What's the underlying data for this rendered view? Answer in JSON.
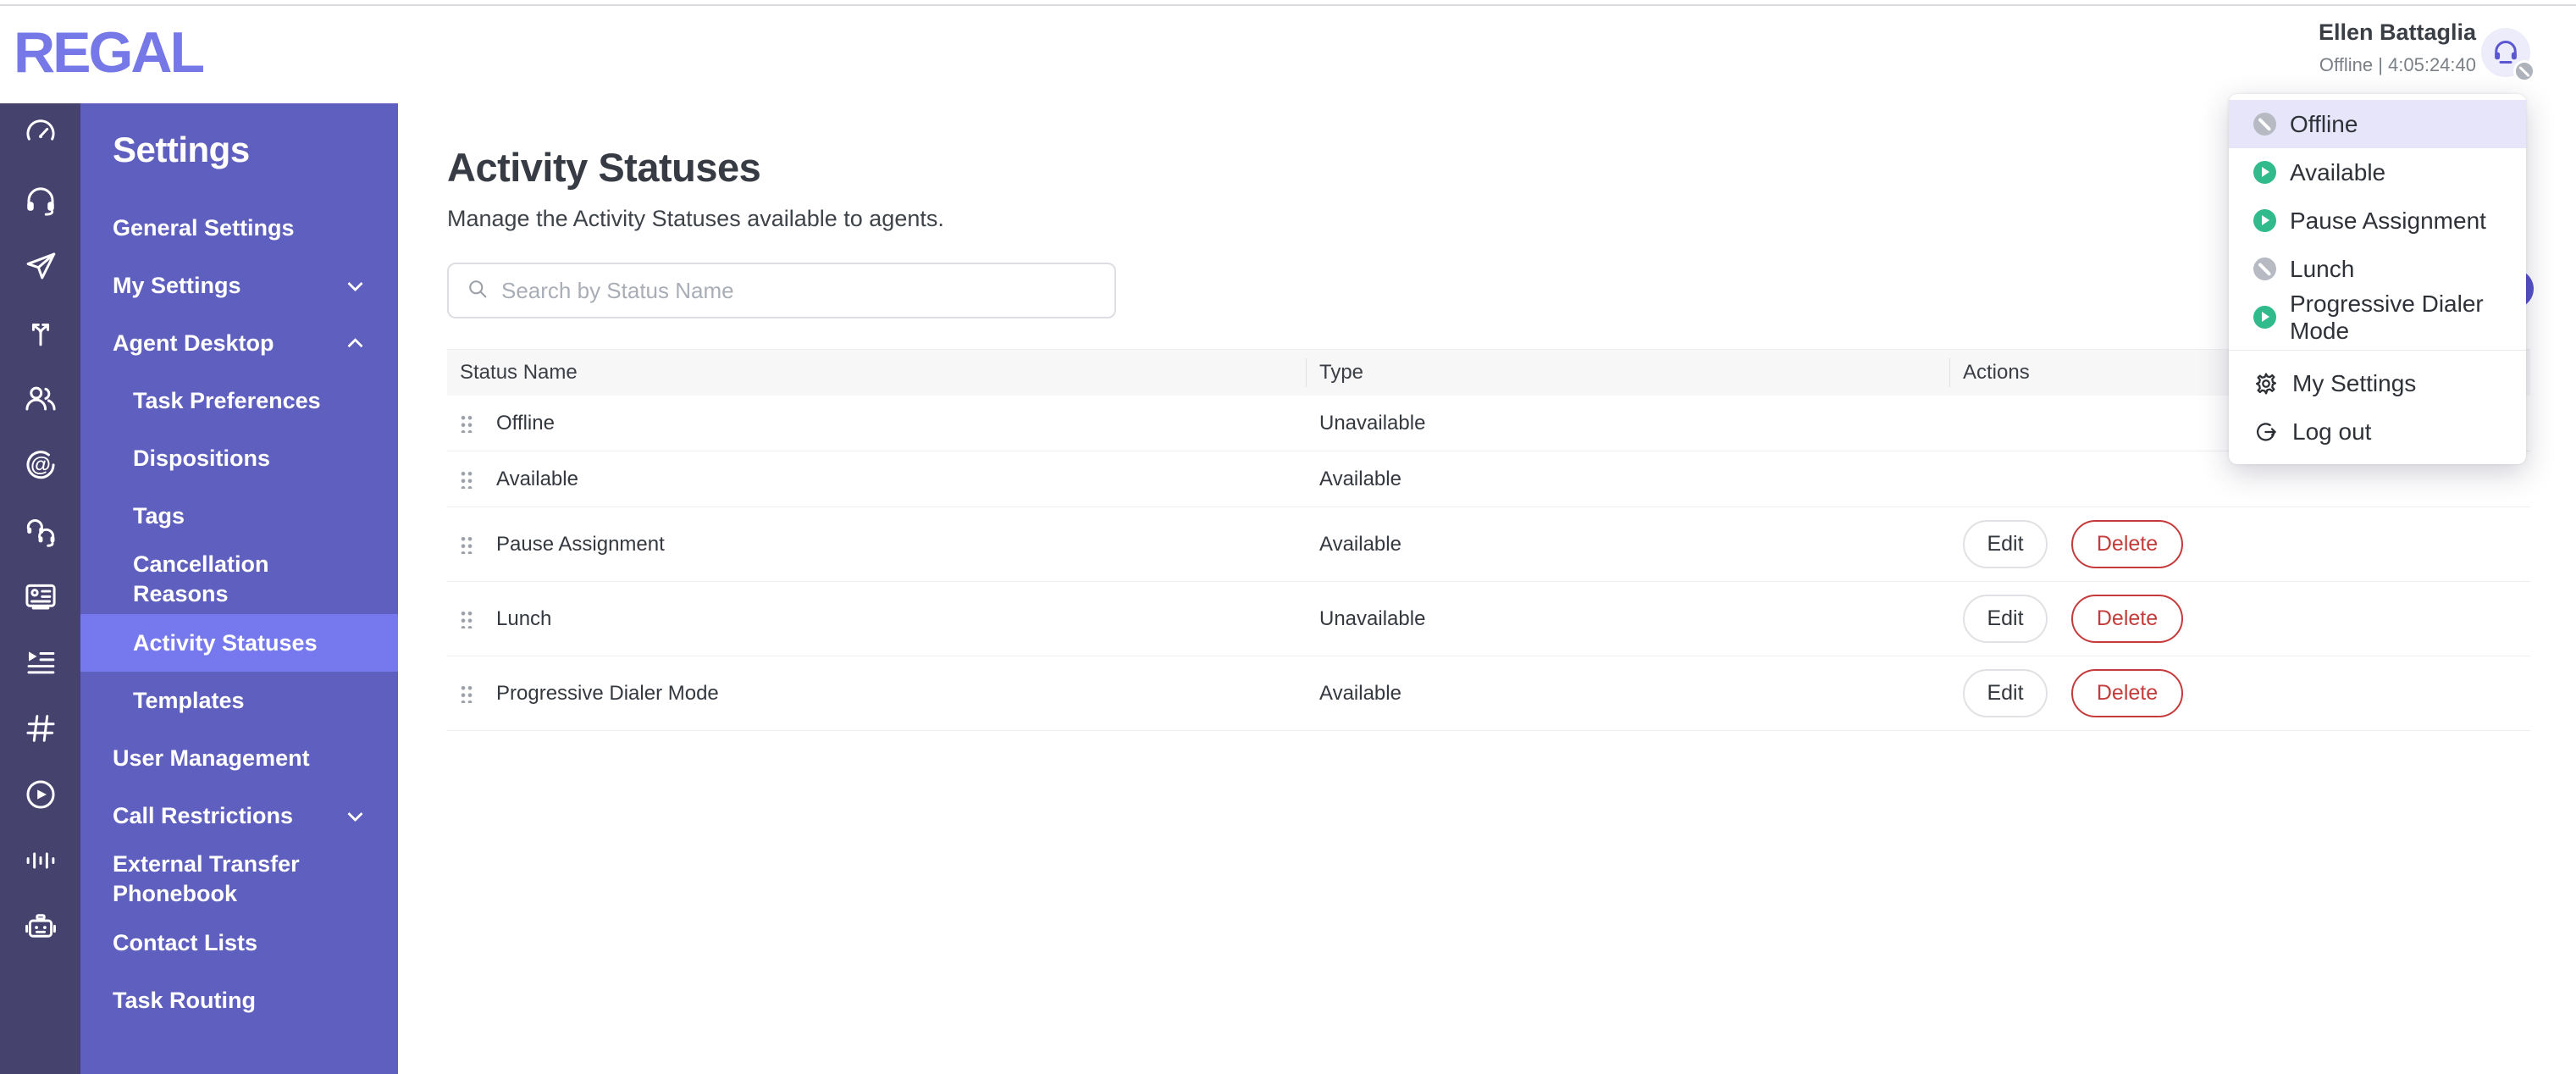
{
  "brand": {
    "logo_text": "REGAL",
    "brand_color": "#7678e8"
  },
  "topbar": {
    "user_name": "Ellen Battaglia",
    "status_line": "Offline | 4:05:24:40"
  },
  "rail": {
    "icons": [
      "gauge",
      "headset",
      "paper-plane",
      "branch-split",
      "users",
      "target-at",
      "dual-headset",
      "contact-card",
      "playlist",
      "hash",
      "play-circle",
      "waveform",
      "robot"
    ]
  },
  "sidebar": {
    "title": "Settings",
    "items": [
      {
        "label": "General Settings",
        "level": 1
      },
      {
        "label": "My Settings",
        "level": 1,
        "chevron": "down"
      },
      {
        "label": "Agent Desktop",
        "level": 1,
        "chevron": "up"
      },
      {
        "label": "Task Preferences",
        "level": 2
      },
      {
        "label": "Dispositions",
        "level": 2
      },
      {
        "label": "Tags",
        "level": 2
      },
      {
        "label": "Cancellation Reasons",
        "level": 2
      },
      {
        "label": "Activity Statuses",
        "level": 2,
        "active": true
      },
      {
        "label": "Templates",
        "level": 2
      },
      {
        "label": "User Management",
        "level": 1
      },
      {
        "label": "Call Restrictions",
        "level": 1,
        "chevron": "down"
      },
      {
        "label": "External Transfer Phonebook",
        "level": 1
      },
      {
        "label": "Contact Lists",
        "level": 1
      },
      {
        "label": "Task Routing",
        "level": 1
      }
    ]
  },
  "main": {
    "title": "Activity Statuses",
    "subtitle": "Manage the Activity Statuses available to agents.",
    "search_placeholder": "Search by Status Name"
  },
  "table": {
    "columns": [
      "Status Name",
      "Type",
      "Actions"
    ],
    "edit_label": "Edit",
    "delete_label": "Delete",
    "rows": [
      {
        "name": "Offline",
        "type": "Unavailable",
        "has_actions": false
      },
      {
        "name": "Available",
        "type": "Available",
        "has_actions": false
      },
      {
        "name": "Pause Assignment",
        "type": "Available",
        "has_actions": true
      },
      {
        "name": "Lunch",
        "type": "Unavailable",
        "has_actions": true
      },
      {
        "name": "Progressive Dialer Mode",
        "type": "Available",
        "has_actions": true
      }
    ]
  },
  "user_menu": {
    "statuses": [
      {
        "label": "Offline",
        "kind": "gray",
        "selected": true
      },
      {
        "label": "Available",
        "kind": "green",
        "selected": false
      },
      {
        "label": "Pause Assignment",
        "kind": "green",
        "selected": false
      },
      {
        "label": "Lunch",
        "kind": "gray",
        "selected": false
      },
      {
        "label": "Progressive Dialer Mode",
        "kind": "green",
        "selected": false
      }
    ],
    "my_settings_label": "My Settings",
    "log_out_label": "Log out"
  },
  "colors": {
    "rail_bg": "#45436e",
    "sidebar_bg": "#5e5fbe",
    "sidebar_active_bg": "#7678ee",
    "menu_selected_bg": "#e6e5f9",
    "available_green": "#31ba8c",
    "unavailable_gray": "#b7bac2",
    "delete_red": "#c53b3b",
    "primary_indigo": "#5551cb"
  }
}
